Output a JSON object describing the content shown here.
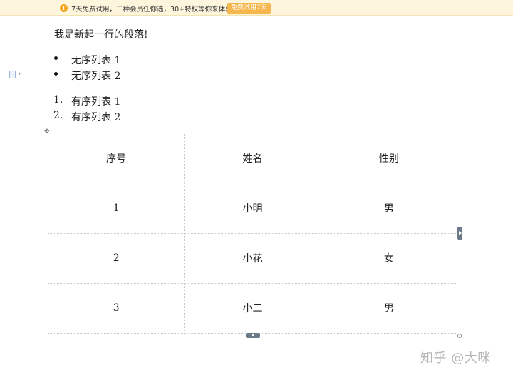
{
  "banner": {
    "icon": "warning-circle-icon",
    "message": "7天免费试用，三种会员任你选，30+特权等你来体验",
    "button_label": "免费试用7天",
    "accent": "#f6b64e"
  },
  "editor": {
    "paragraph": "我是新起一行的段落!",
    "unordered_list": [
      "无序列表 1",
      "无序列表 2"
    ],
    "ordered_list": [
      {
        "num": "1.",
        "text": "有序列表 1"
      },
      {
        "num": "2.",
        "text": "有序列表 2"
      }
    ],
    "table": {
      "headers": [
        "序号",
        "姓名",
        "性别"
      ],
      "rows": [
        [
          "1",
          "小明",
          "男"
        ],
        [
          "2",
          "小花",
          "女"
        ],
        [
          "3",
          "小二",
          "男"
        ]
      ]
    }
  },
  "watermark": "知乎 @大咪"
}
